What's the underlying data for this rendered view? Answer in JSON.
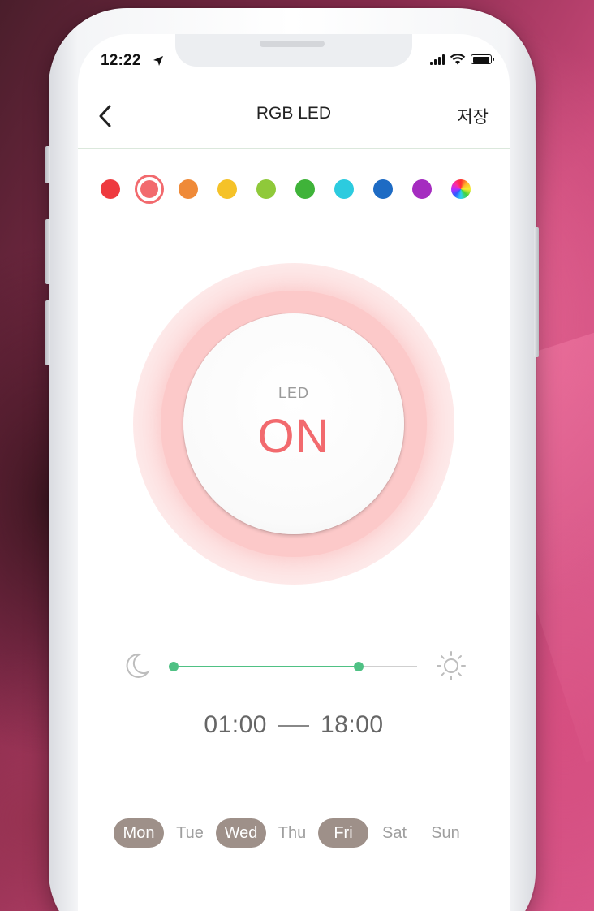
{
  "status_bar": {
    "time": "12:22",
    "icons": [
      "location-arrow-icon",
      "cellular-signal-icon",
      "wifi-icon",
      "battery-icon"
    ]
  },
  "nav": {
    "back_icon": "chevron-left-icon",
    "title": "RGB LED",
    "save_label": "저장"
  },
  "palette": {
    "selected_index": 1,
    "colors": [
      {
        "name": "red",
        "hex": "#ee3a3f"
      },
      {
        "name": "coral",
        "hex": "#f26a6e"
      },
      {
        "name": "orange",
        "hex": "#ef8a38"
      },
      {
        "name": "yellow",
        "hex": "#f5c228"
      },
      {
        "name": "lime",
        "hex": "#8fc93a"
      },
      {
        "name": "green",
        "hex": "#3fb339"
      },
      {
        "name": "cyan",
        "hex": "#2ccbdf"
      },
      {
        "name": "blue",
        "hex": "#1d6bc4"
      },
      {
        "name": "purple",
        "hex": "#a52cc0"
      },
      {
        "name": "rainbow",
        "hex": "multicolor"
      }
    ]
  },
  "led": {
    "label": "LED",
    "state": "ON",
    "accent": "#f26a6e"
  },
  "schedule": {
    "start_position": 0.0,
    "end_position": 0.76,
    "start_time": "01:00",
    "end_time": "18:00",
    "left_icon": "moon-icon",
    "right_icon": "sun-icon",
    "accent": "#4fc184"
  },
  "days": [
    {
      "label": "Mon",
      "active": true
    },
    {
      "label": "Tue",
      "active": false
    },
    {
      "label": "Wed",
      "active": true
    },
    {
      "label": "Thu",
      "active": false
    },
    {
      "label": "Fri",
      "active": true
    },
    {
      "label": "Sat",
      "active": false
    },
    {
      "label": "Sun",
      "active": false
    }
  ]
}
